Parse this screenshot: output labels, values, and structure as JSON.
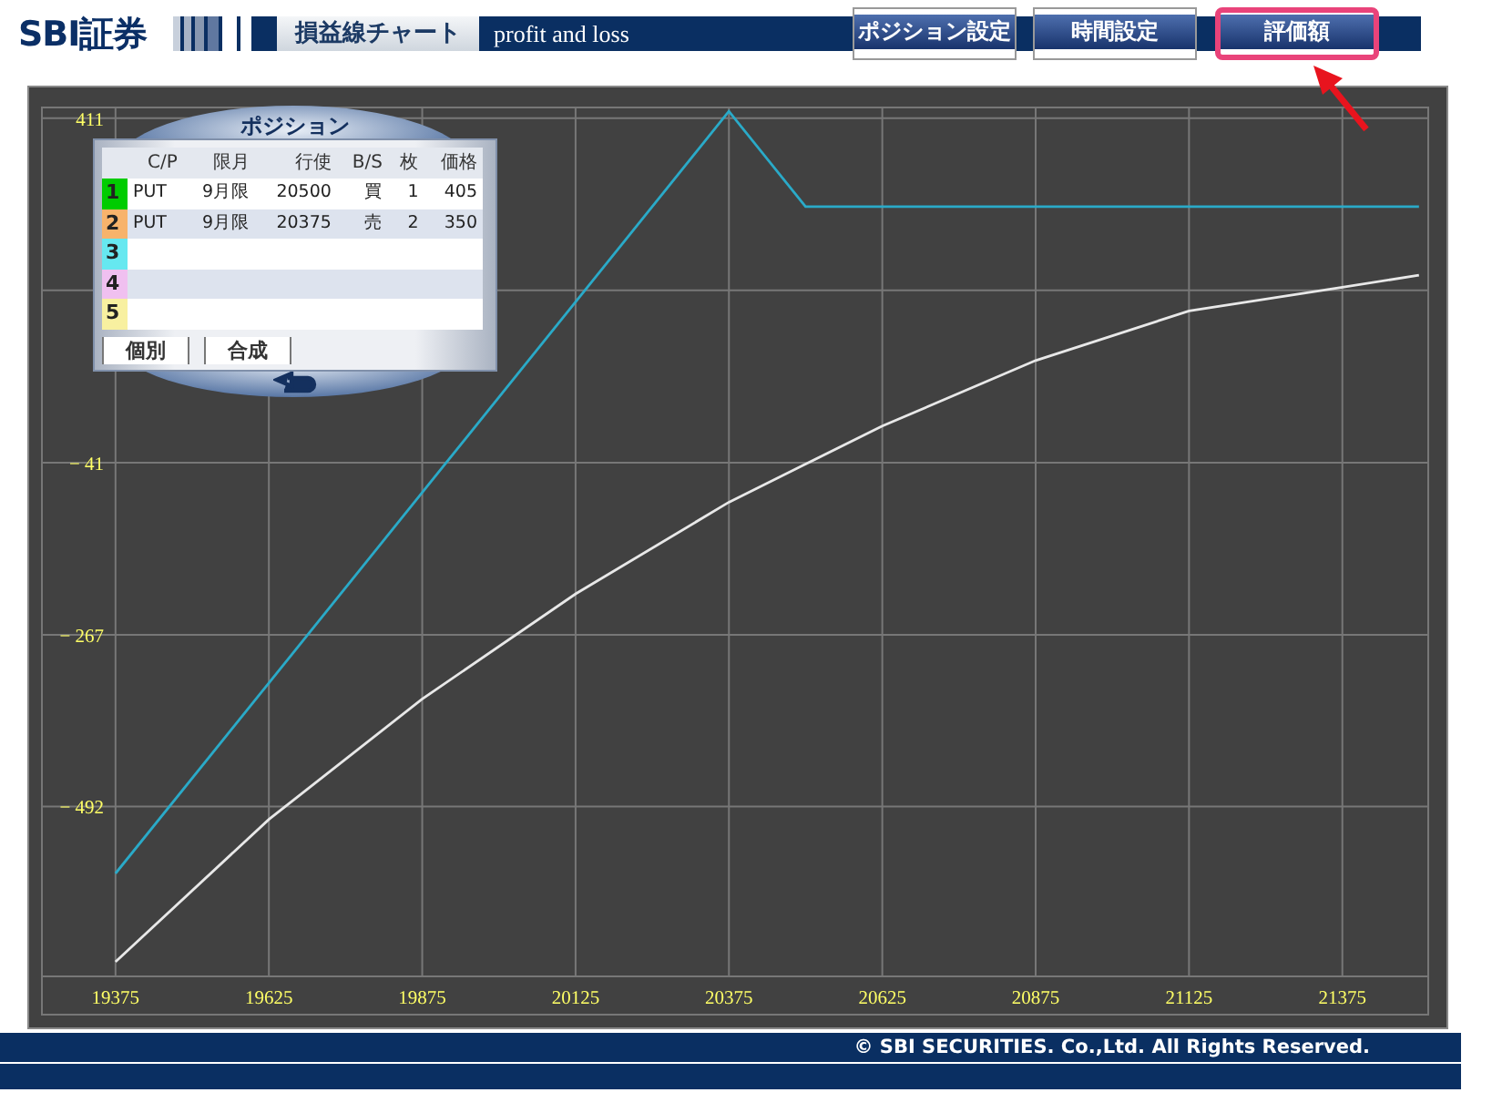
{
  "header": {
    "logo": "SBI証券",
    "tab": "損益線チャート",
    "subtitle": "profit and loss",
    "buttons": [
      {
        "label": "ポジション設定",
        "highlighted": false
      },
      {
        "label": "時間設定",
        "highlighted": false
      },
      {
        "label": "評価額",
        "highlighted": true
      }
    ]
  },
  "positions": {
    "title": "ポジション",
    "columns": [
      "C/P",
      "限月",
      "行使",
      "B/S",
      "枚",
      "価格"
    ],
    "rows": [
      {
        "number": "1",
        "color": "#00cc00",
        "cells": [
          "PUT",
          "9月限",
          "20500",
          "買",
          "1",
          "405"
        ]
      },
      {
        "number": "2",
        "color": "#f7b36b",
        "cells": [
          "PUT",
          "9月限",
          "20375",
          "売",
          "2",
          "350"
        ]
      },
      {
        "number": "3",
        "color": "#66e8f0"
      },
      {
        "number": "4",
        "color": "#f0c0f0"
      },
      {
        "number": "5",
        "color": "#f8f0a0"
      }
    ],
    "buttons": [
      "個別",
      "合成"
    ]
  },
  "chart": {
    "chart_data": {
      "type": "line",
      "x": [
        19375,
        19625,
        19875,
        20125,
        20375,
        20500,
        20625,
        20875,
        21125,
        21375,
        21500
      ],
      "series": [
        {
          "color": "#2aaac8",
          "values": [
            -580,
            -330,
            -80,
            170,
            420,
            295,
            295,
            295,
            295,
            295,
            295
          ]
        },
        {
          "color": "#e8e8e8",
          "values": [
            -696,
            -509,
            -351,
            -213,
            -93,
            -43,
            7,
            93,
            158,
            189,
            205
          ]
        }
      ],
      "xlim": [
        19255,
        21515
      ],
      "ylim": [
        -715,
        425
      ],
      "xticks": [
        19375,
        19625,
        19875,
        20125,
        20375,
        20625,
        20875,
        21125,
        21375
      ],
      "yticks": [
        {
          "value": 411,
          "label": "411"
        },
        {
          "value": -41,
          "label": "− 41"
        },
        {
          "value": -267,
          "label": "− 267"
        },
        {
          "value": -492,
          "label": "− 492"
        }
      ],
      "grid": true
    }
  },
  "footer": {
    "copyright": "© SBI SECURITIES. Co.,Ltd. All Rights Reserved."
  }
}
